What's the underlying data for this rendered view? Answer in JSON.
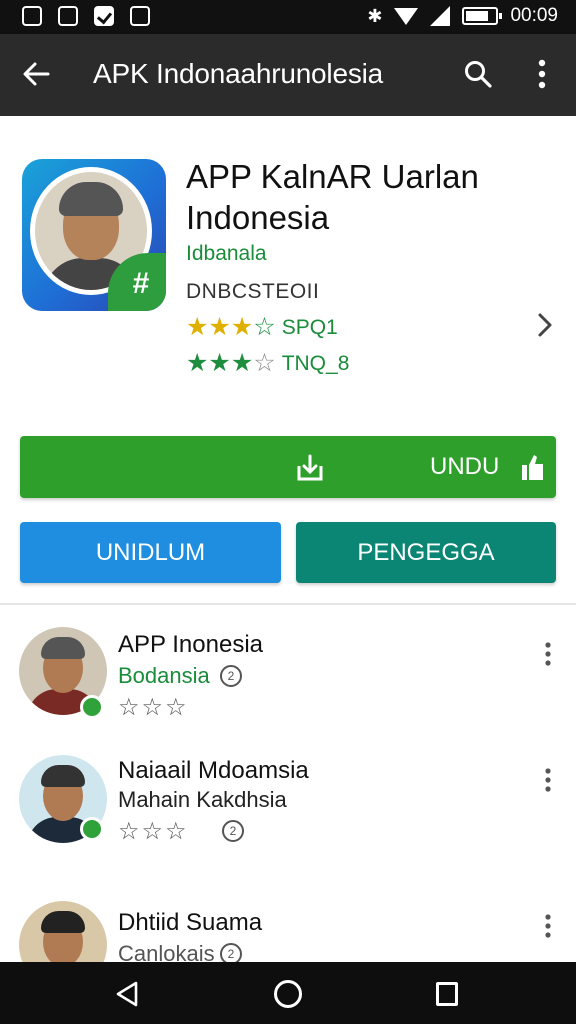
{
  "status_bar": {
    "time": "00:09",
    "battery_level_fraction": 0.74,
    "icons": [
      "image-icon",
      "screenshot-icon",
      "checkbox-icon",
      "stats-icon",
      "bluetooth-icon",
      "wifi-icon",
      "signal-icon",
      "battery-icon"
    ]
  },
  "app_bar": {
    "title": "APK Indonaahrunolesia",
    "icons": [
      "back-arrow-icon",
      "search-icon",
      "more-vert-icon"
    ]
  },
  "app": {
    "title": "APP KalnAR Uarlan Indonesia",
    "developer": "Idbanala",
    "size": "DNBCSTEOII",
    "rating_1_text": "SPQ1",
    "rating_1_stars_filled": 3,
    "rating_1_stars_total": 4,
    "rating_2_text": "TNQ_8",
    "rating_2_stars_filled": 3,
    "rating_2_stars_total": 4
  },
  "buttons": {
    "install_label": "UNDU",
    "secondary_label": "UNIDLUM",
    "primary_label": "PENGEGGA"
  },
  "list_items": [
    {
      "title": "APP Inonesia",
      "subtitle": "Bodansia",
      "stars_total": 3
    },
    {
      "title": "Naiaail Mdoamsia",
      "subtitle": "Mahain  Kakdhsia",
      "stars_total": 3
    },
    {
      "title": "Dhtiid Suama",
      "subtitle": "Canlokais"
    }
  ],
  "colors": {
    "app_bar": "#2b2b2b",
    "install_button": "#2f9f2c",
    "secondary_button": "#1f8ee0",
    "primary_button": "#0b8574",
    "developer_text": "#1a8c3a",
    "star_gold": "#e0b000",
    "star_green": "#1e8e3e"
  }
}
